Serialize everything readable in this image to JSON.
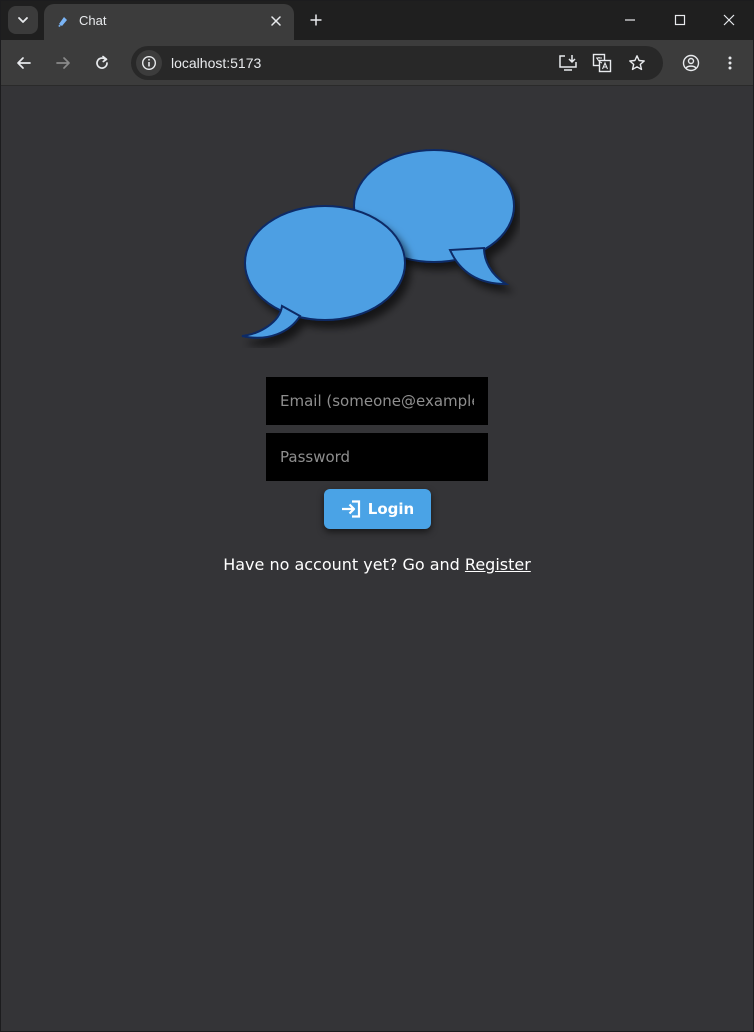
{
  "browser": {
    "tab_title": "Chat",
    "url": "localhost:5173"
  },
  "login_form": {
    "email_placeholder": "Email (someone@example.com)",
    "password_placeholder": "Password",
    "login_label": "Login"
  },
  "footer": {
    "prompt": "Have no account yet? Go and",
    "register_link": "Register"
  },
  "colors": {
    "page_background": "#343437",
    "accent": "#4aa3e6",
    "input_background": "#000000"
  },
  "icons": {
    "logo": "chat-bubbles-icon",
    "login": "login-arrow-icon"
  }
}
